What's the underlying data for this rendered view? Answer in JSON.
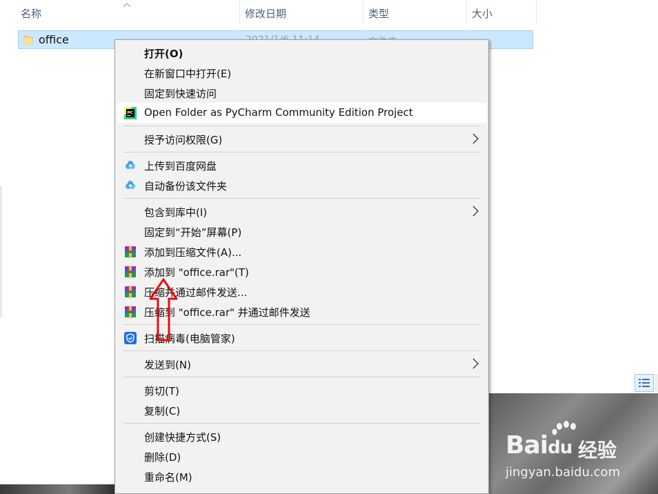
{
  "explorer": {
    "columns": [
      "名称",
      "修改日期",
      "类型",
      "大小"
    ],
    "file": {
      "name": "office",
      "modified": "2021/1/6 11:14",
      "type": "文件夹"
    }
  },
  "menu": {
    "open": "打开(O)",
    "open_new_window": "在新窗口中打开(E)",
    "pin_quick_access": "固定到快速访问",
    "open_pycharm": "Open Folder as PyCharm Community Edition Project",
    "grant_access": "授予访问权限(G)",
    "upload_baidu": "上传到百度网盘",
    "auto_backup": "自动备份该文件夹",
    "include_library": "包含到库中(I)",
    "pin_start": "固定到“开始”屏幕(P)",
    "add_archive": "添加到压缩文件(A)...",
    "add_office_rar": "添加到 \"office.rar\"(T)",
    "compress_email": "压缩并通过邮件发送...",
    "compress_office_email": "压缩到 \"office.rar\" 并通过邮件发送",
    "scan_virus": "扫描病毒(电脑管家)",
    "send_to": "发送到(N)",
    "cut": "剪切(T)",
    "copy": "复制(C)",
    "create_shortcut": "创建快捷方式(S)",
    "delete": "删除(D)",
    "rename": "重命名(M)"
  },
  "watermark": {
    "brand": "Bai",
    "brand_cn": "经验",
    "url": "jingyan.baidu.com"
  },
  "colors": {
    "selection": "#cce8ff",
    "annotation_arrow": "#e01010",
    "menu_bg": "#f2f2f2"
  }
}
